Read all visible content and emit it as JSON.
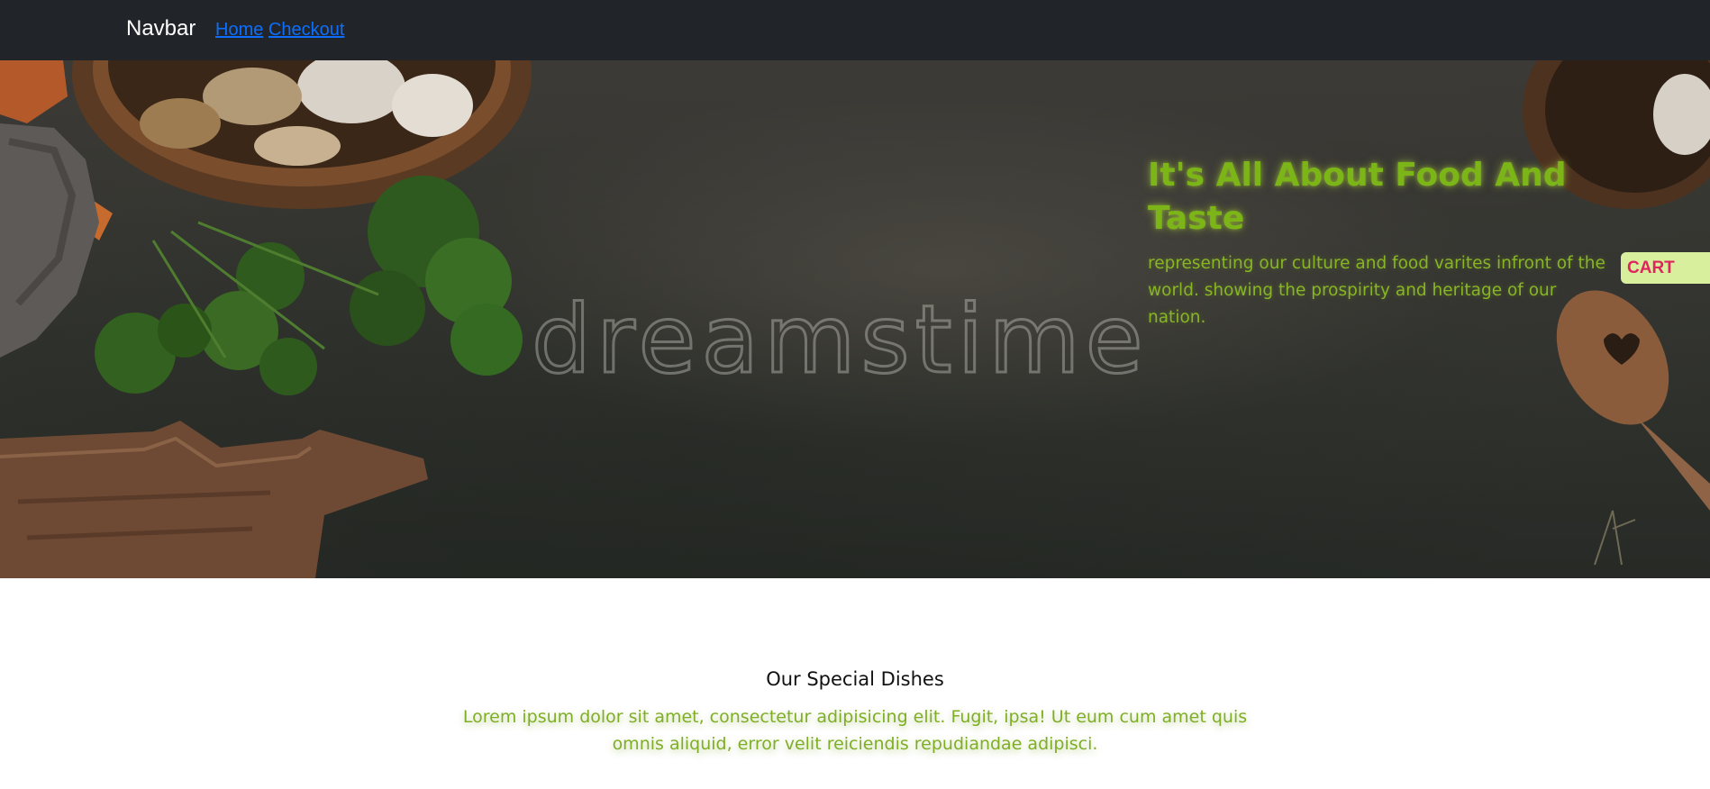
{
  "navbar": {
    "brand": "Navbar",
    "links": [
      {
        "label": "Home"
      },
      {
        "label": "Checkout"
      }
    ]
  },
  "hero": {
    "title": "It's All About Food And Taste",
    "subtitle": "representing our culture and food varites infront of the world. showing the prospirity and heritage of our nation.",
    "cart_label": "CART",
    "watermark": "dreamstime"
  },
  "section": {
    "title": "Our Special Dishes",
    "text": "Lorem ipsum dolor sit amet, consectetur adipisicing elit. Fugit, ipsa! Ut eum cum amet quis omnis aliquid, error velit reiciendis repudiandae adipisci."
  },
  "colors": {
    "navbar_bg": "#212529",
    "link": "#0d6efd",
    "accent_green": "#7cb518",
    "cart_bg": "#d8ef9e",
    "cart_text": "#e0245e"
  }
}
